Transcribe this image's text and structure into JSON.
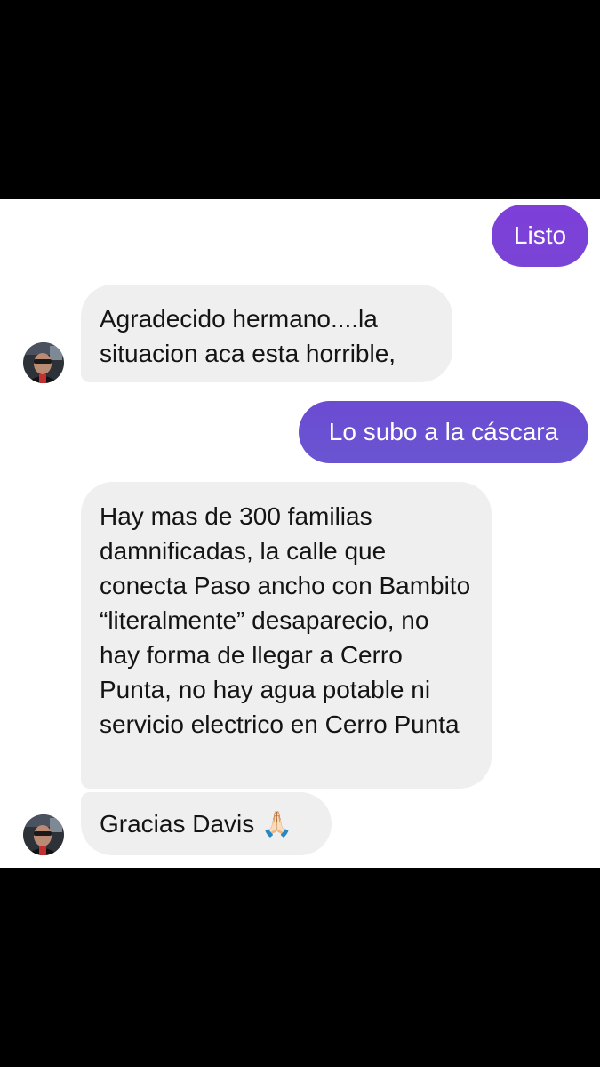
{
  "messages": [
    {
      "id": "m1",
      "direction": "outgoing",
      "text": "Listo"
    },
    {
      "id": "m2",
      "direction": "incoming",
      "text": "Agradecido hermano....la situacion aca esta horrible,"
    },
    {
      "id": "m3",
      "direction": "outgoing",
      "text": "Lo subo a la cáscara"
    },
    {
      "id": "m4",
      "direction": "incoming",
      "text": "Hay mas de 300 familias damnificadas, la calle que conecta Paso ancho con Bambito “literalmente” desaparecio, no hay forma de llegar a Cerro Punta, no hay agua potable ni servicio electrico en Cerro Punta"
    },
    {
      "id": "m5",
      "direction": "incoming",
      "text": "Gracias Davis 🙏🏻"
    }
  ],
  "avatar": {
    "icon": "contact-avatar-photo"
  },
  "colors": {
    "outgoing_gradient_top": "#7a42d6",
    "outgoing_gradient_bottom": "#6b4fd0",
    "incoming_bubble": "#efefef",
    "letterbox": "#000000",
    "background": "#ffffff"
  }
}
